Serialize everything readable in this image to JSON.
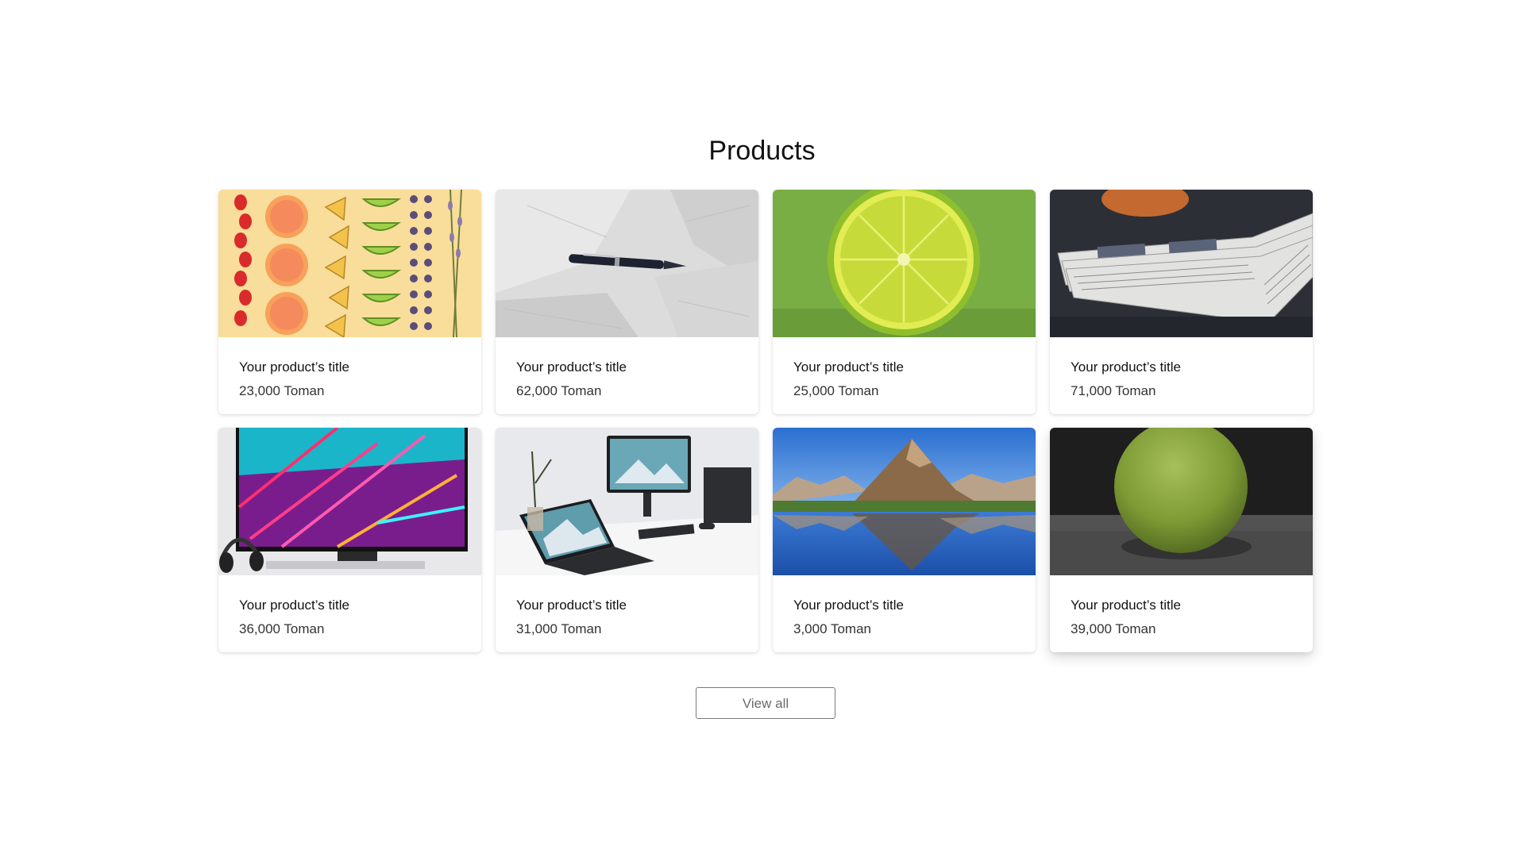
{
  "section": {
    "title": "Products",
    "view_all_label": "View all"
  },
  "products": [
    {
      "title": "Your product’s title",
      "price": "23,000 Toman",
      "image": "fruit-flatlay"
    },
    {
      "title": "Your product’s title",
      "price": "62,000 Toman",
      "image": "pen-on-paper"
    },
    {
      "title": "Your product’s title",
      "price": "25,000 Toman",
      "image": "lime-slice"
    },
    {
      "title": "Your product’s title",
      "price": "71,000 Toman",
      "image": "newspaper-stack"
    },
    {
      "title": "Your product’s title",
      "price": "36,000 Toman",
      "image": "gaming-monitor"
    },
    {
      "title": "Your product’s title",
      "price": "31,000 Toman",
      "image": "desk-setup"
    },
    {
      "title": "Your product’s title",
      "price": "3,000 Toman",
      "image": "mountain-lake"
    },
    {
      "title": "Your product’s title",
      "price": "39,000 Toman",
      "image": "green-pear"
    }
  ]
}
